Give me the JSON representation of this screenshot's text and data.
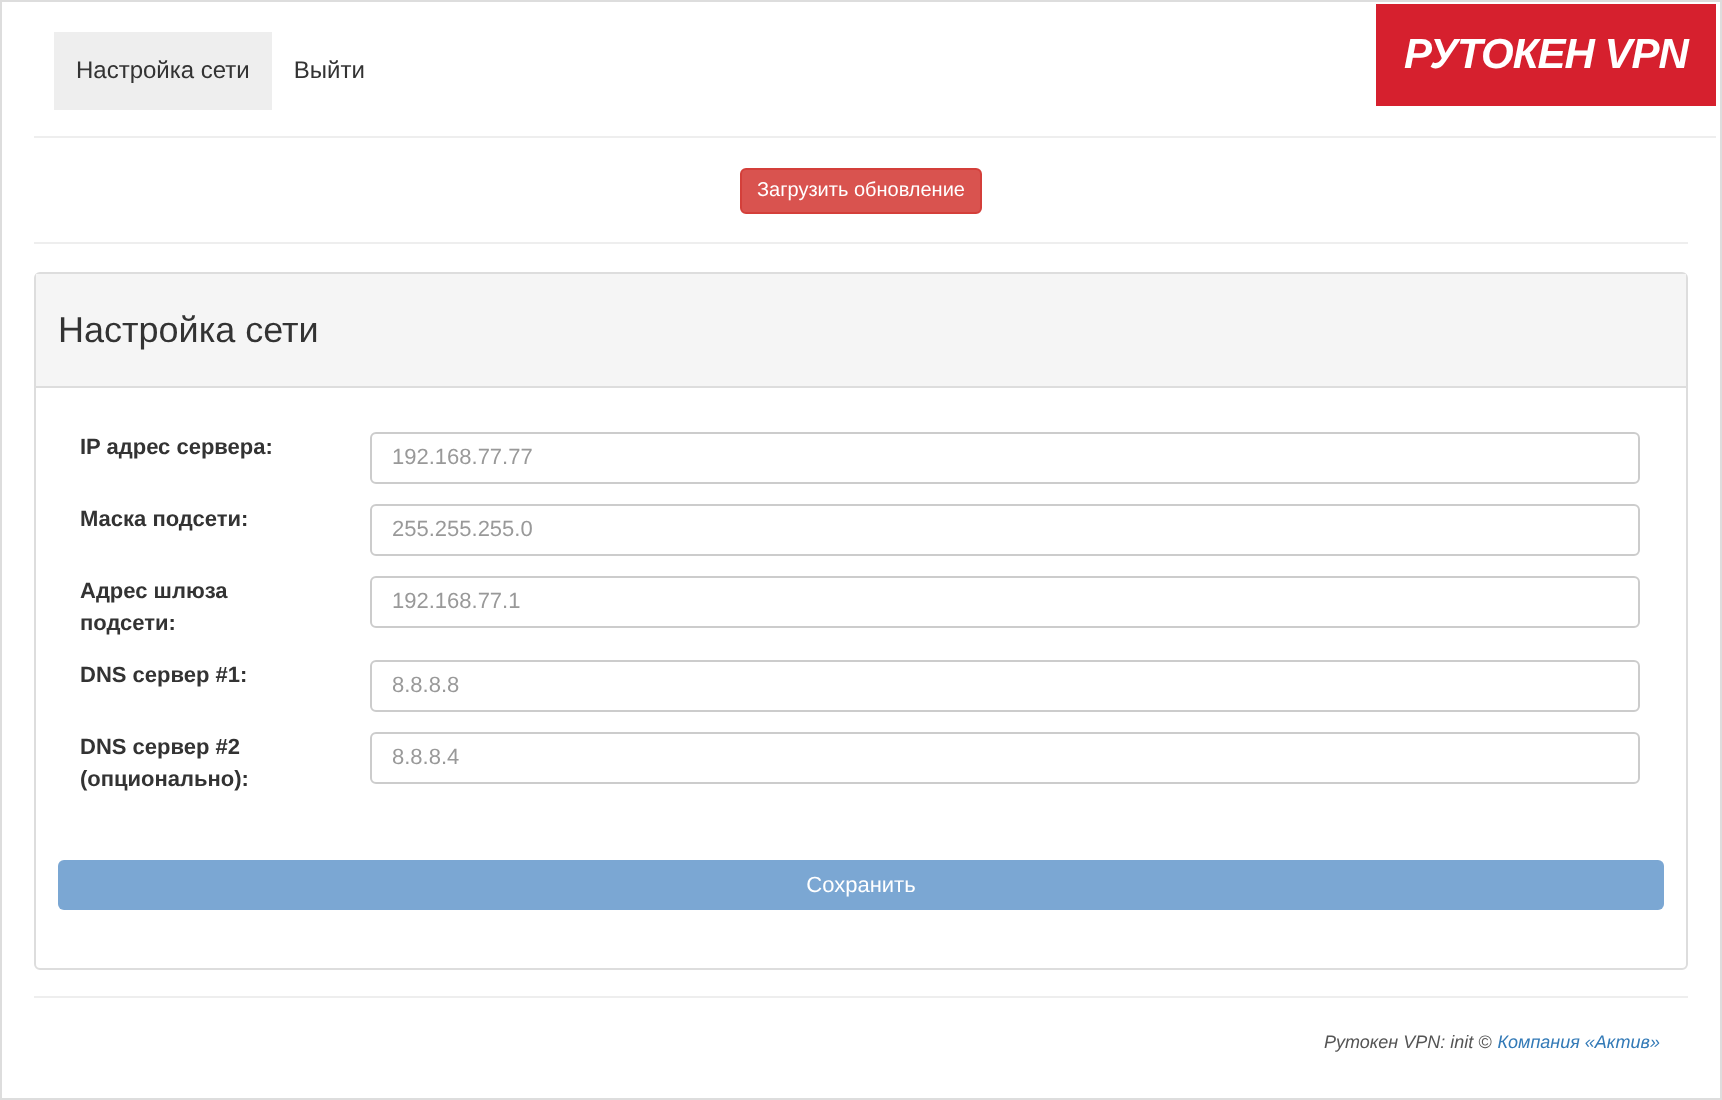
{
  "nav": {
    "tabs": [
      {
        "label": "Настройка сети",
        "selected": true
      },
      {
        "label": "Выйти",
        "selected": false
      }
    ],
    "logo": "РУТОКЕН VPN"
  },
  "update_button": "Загрузить обновление",
  "panel": {
    "title": "Настройка сети",
    "fields": [
      {
        "label": "IP адрес сервера:",
        "placeholder": "192.168.77.77"
      },
      {
        "label": "Маска подсети:",
        "placeholder": "255.255.255.0"
      },
      {
        "label": "Адрес шлюза подсети:",
        "placeholder": "192.168.77.1"
      },
      {
        "label": "DNS сервер #1:",
        "placeholder": "8.8.8.8"
      },
      {
        "label": "DNS сервер #2 (опционально):",
        "placeholder": "8.8.8.4"
      }
    ],
    "save_button": "Сохранить"
  },
  "footer": {
    "text": "Рутокен VPN: init ©",
    "link": "Компания «Актив»"
  }
}
